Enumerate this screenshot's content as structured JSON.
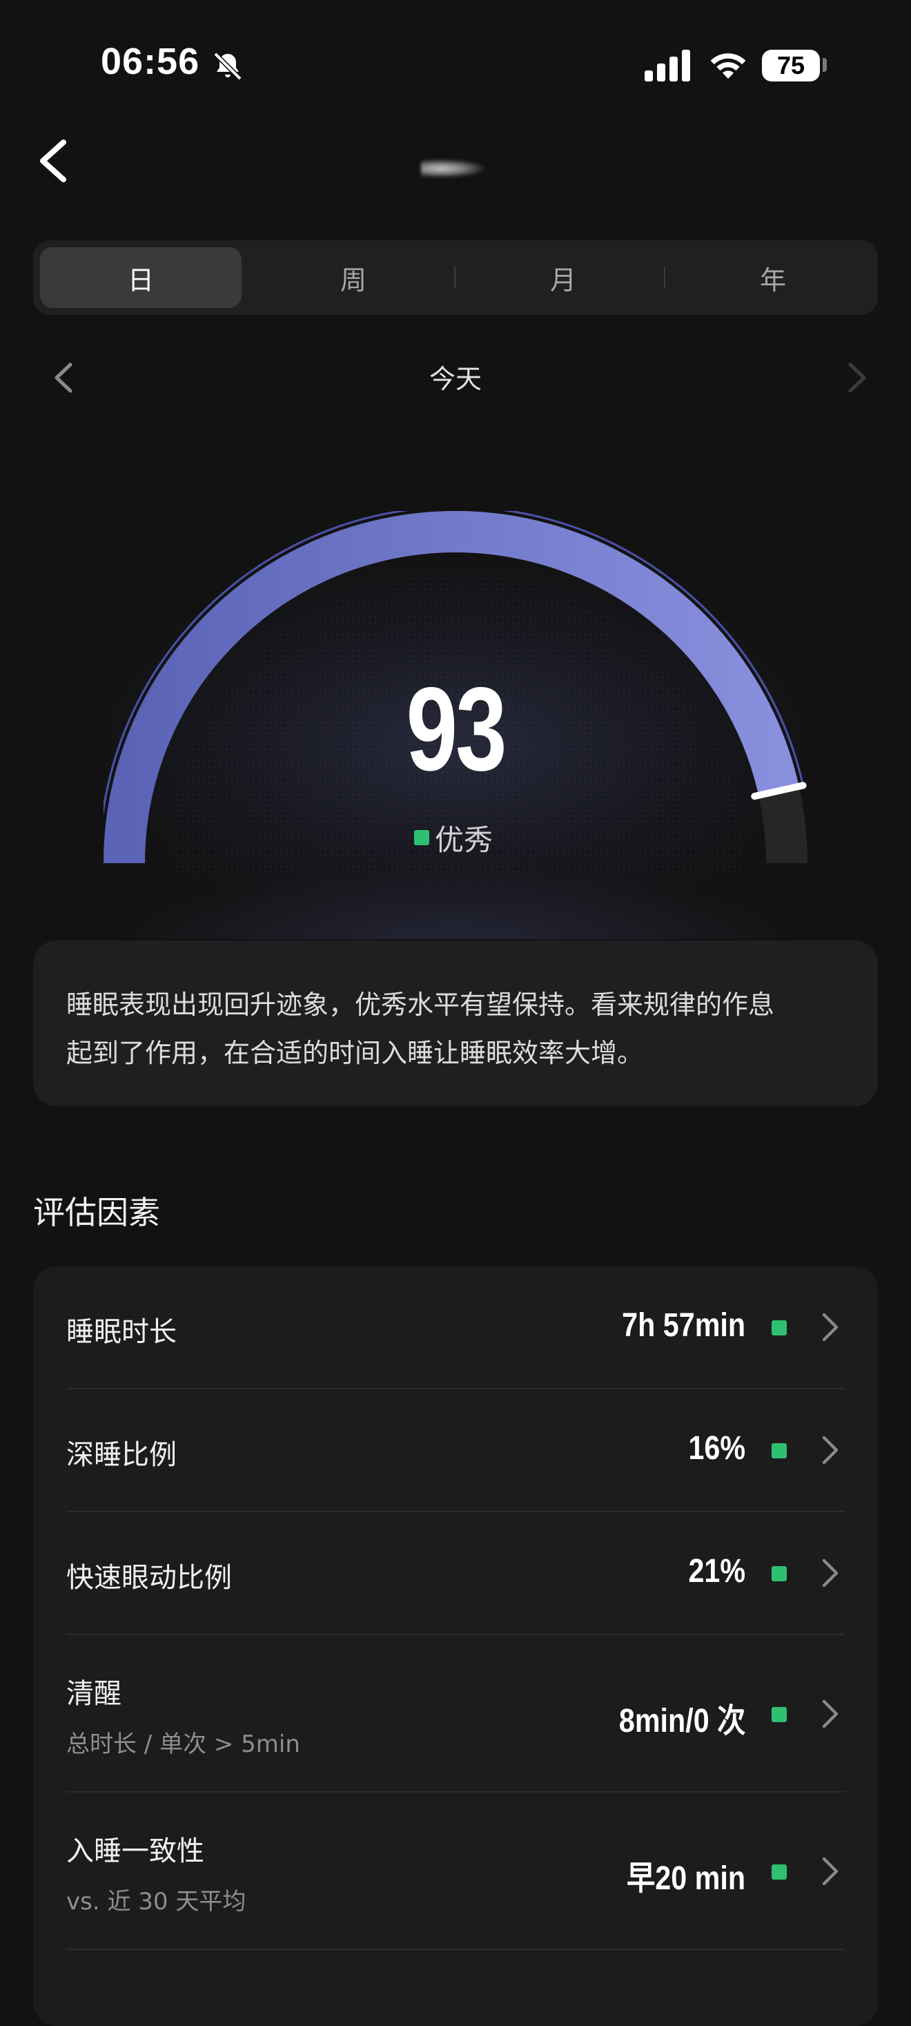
{
  "status_bar": {
    "time": "06:56",
    "battery": "75",
    "icons": [
      "bell-off-icon",
      "signal-icon",
      "wifi-icon",
      "battery-icon"
    ]
  },
  "nav": {
    "back_icon": "chevron-left-icon"
  },
  "tabs": [
    {
      "label": "日",
      "active": true
    },
    {
      "label": "周",
      "active": false
    },
    {
      "label": "月",
      "active": false
    },
    {
      "label": "年",
      "active": false
    }
  ],
  "date_nav": {
    "label": "今天",
    "prev_icon": "chevron-left-icon",
    "next_icon": "chevron-right-icon"
  },
  "gauge": {
    "score": "93",
    "score_value": 93,
    "score_max": 100,
    "level": "优秀",
    "level_color": "#2fbf71",
    "arc_color_start": "#5a63b6",
    "arc_color_end": "#8890de",
    "track_color": "#262626"
  },
  "summary": {
    "line1": "睡眠表现出现回升迹象，优秀水平有望保持。看来规律的作息",
    "line2": "起到了作用，在合适的时间入睡让睡眠效率大增。"
  },
  "factors": {
    "title": "评估因素",
    "items": [
      {
        "label": "睡眠时长",
        "sub": "",
        "value": "7h 57min",
        "status_color": "#2fbf71"
      },
      {
        "label": "深睡比例",
        "sub": "",
        "value": "16%",
        "status_color": "#2fbf71"
      },
      {
        "label": "快速眼动比例",
        "sub": "",
        "value": "21%",
        "status_color": "#2fbf71"
      },
      {
        "label": "清醒",
        "sub": "总时长 / 单次 > 5min",
        "value": "8min/0 次",
        "status_color": "#2fbf71"
      },
      {
        "label": "入睡一致性",
        "sub": "vs. 近 30 天平均",
        "value": "早20 min",
        "status_color": "#2fbf71"
      }
    ]
  }
}
